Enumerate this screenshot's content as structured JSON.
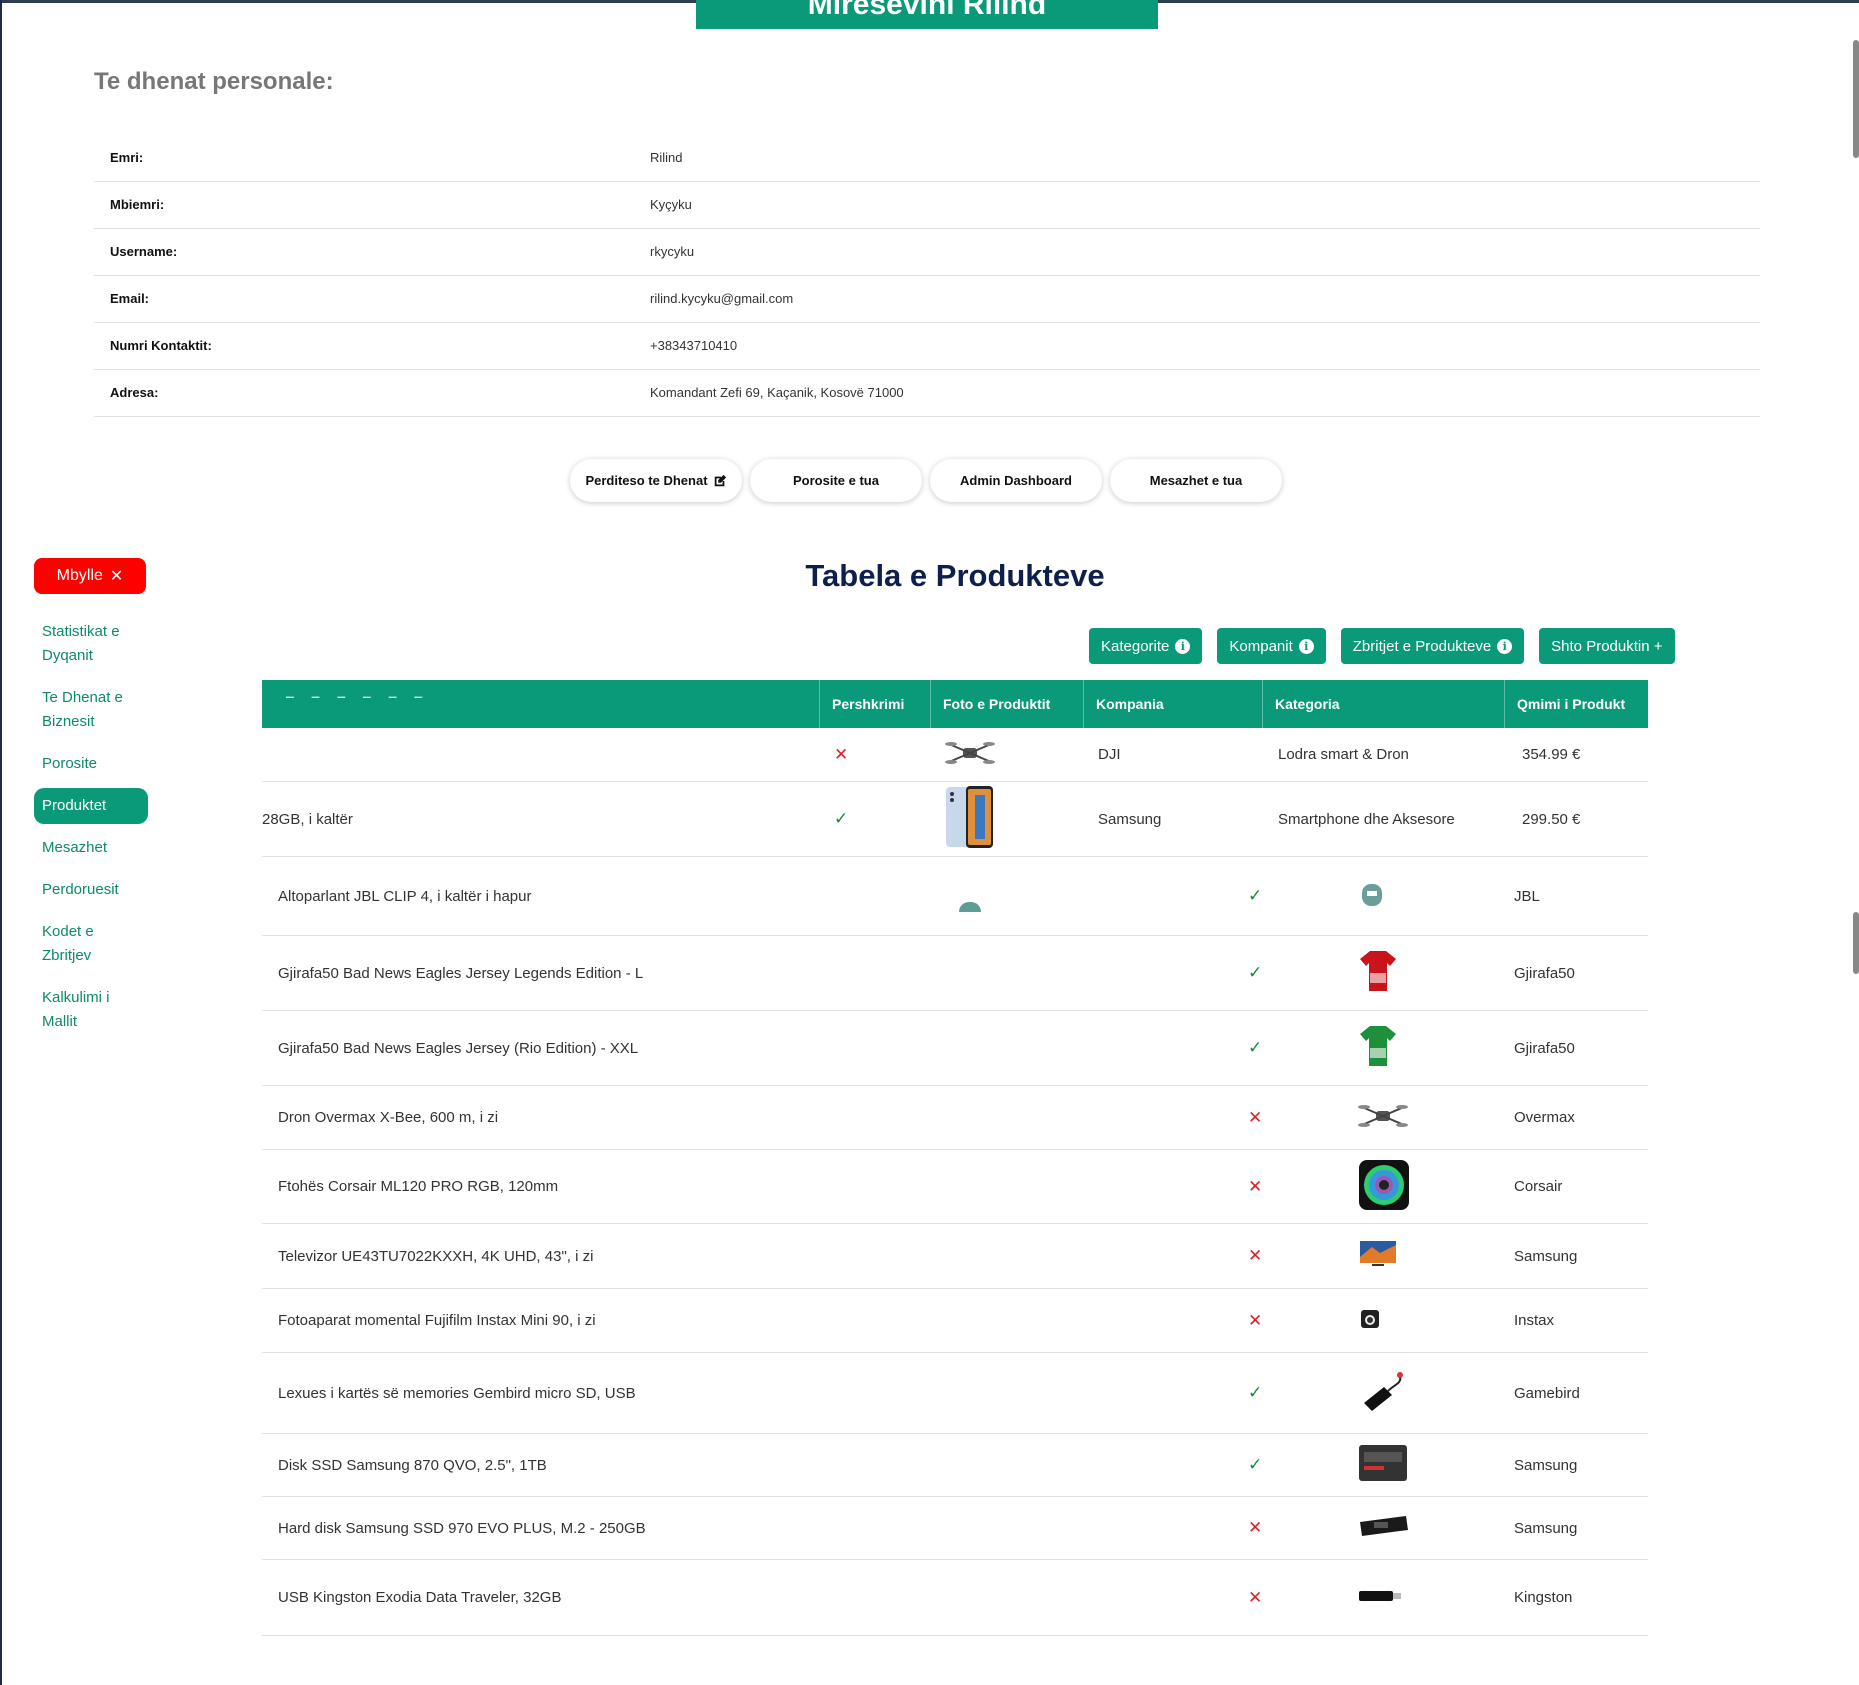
{
  "banner": {
    "title": "Mirësevini Rilind"
  },
  "profile": {
    "section_title": "Te dhenat personale:",
    "rows": [
      {
        "label": "Emri:",
        "value": "Rilind"
      },
      {
        "label": "Mbiemri:",
        "value": "Kyçyku"
      },
      {
        "label": "Username:",
        "value": "rkycyku"
      },
      {
        "label": "Email:",
        "value": "rilind.kycyku@gmail.com"
      },
      {
        "label": "Numri Kontaktit:",
        "value": "+38343710410"
      },
      {
        "label": "Adresa:",
        "value": "Komandant Zefi 69, Kaçanik, Kosovë 71000"
      }
    ]
  },
  "actions": {
    "update": "Perditeso te Dhenat",
    "orders": "Porosite e tua",
    "admin": "Admin Dashboard",
    "messages": "Mesazhet e tua"
  },
  "sidebar": {
    "close_label": "Mbylle",
    "items": [
      {
        "label": "Statistikat e Dyqanit",
        "active": false
      },
      {
        "label": "Te Dhenat e Biznesit",
        "active": false
      },
      {
        "label": "Porosite",
        "active": false
      },
      {
        "label": "Produktet",
        "active": true
      },
      {
        "label": "Mesazhet",
        "active": false
      },
      {
        "label": "Perdoruesit",
        "active": false
      },
      {
        "label": "Kodet e Zbritjev",
        "active": false
      },
      {
        "label": "Kalkulimi i Mallit",
        "active": false
      }
    ]
  },
  "products": {
    "title": "Tabela e Produkteve",
    "buttons": {
      "categories": "Kategorite",
      "companies": "Kompanit",
      "discounts": "Zbritjet e Produkteve",
      "add": "Shto Produktin +"
    },
    "headers": {
      "desc": "Pershkrimi",
      "photo": "Foto e Produktit",
      "company": "Kompania",
      "category": "Kategoria",
      "price": "Qmimi i Produkt"
    },
    "top_rows": [
      {
        "name": "",
        "desc_ok": false,
        "photo": "drone-photo",
        "company": "DJI",
        "category": "Lodra smart & Dron",
        "price": "354.99 €"
      },
      {
        "name": "28GB, i kaltër",
        "desc_ok": true,
        "photo": "phone-photo",
        "company": "Samsung",
        "category": "Smartphone dhe Aksesore",
        "price": "299.50 €"
      }
    ],
    "rows": [
      {
        "name": "Altoparlant JBL CLIP 4, i kaltër i hapur",
        "desc_ok": true,
        "photo": "speaker-photo",
        "company": "JBL"
      },
      {
        "name": "Gjirafa50 Bad News Eagles Jersey Legends Edition - L",
        "desc_ok": true,
        "photo": "red-jersey-photo",
        "company": "Gjirafa50"
      },
      {
        "name": "Gjirafa50 Bad News Eagles Jersey (Rio Edition) - XXL",
        "desc_ok": true,
        "photo": "green-jersey-photo",
        "company": "Gjirafa50"
      },
      {
        "name": "Dron Overmax X-Bee, 600 m, i zi",
        "desc_ok": false,
        "photo": "drone-photo",
        "company": "Overmax"
      },
      {
        "name": "Ftohës Corsair ML120 PRO RGB, 120mm",
        "desc_ok": false,
        "photo": "fan-photo",
        "company": "Corsair"
      },
      {
        "name": "Televizor UE43TU7022KXXH, 4K UHD, 43\", i zi",
        "desc_ok": false,
        "photo": "tv-photo",
        "company": "Samsung"
      },
      {
        "name": "Fotoaparat momental Fujifilm Instax Mini 90, i zi",
        "desc_ok": false,
        "photo": "camera-photo",
        "company": "Instax"
      },
      {
        "name": "Lexues i kartës së memories Gembird micro SD, USB",
        "desc_ok": true,
        "photo": "card-reader-photo",
        "company": "Gamebird"
      },
      {
        "name": "Disk SSD Samsung 870 QVO, 2.5\", 1TB",
        "desc_ok": true,
        "photo": "ssd-photo",
        "company": "Samsung"
      },
      {
        "name": "Hard disk Samsung SSD 970 EVO PLUS, M.2 - 250GB",
        "desc_ok": false,
        "photo": "m2-ssd-photo",
        "company": "Samsung"
      },
      {
        "name": "USB Kingston Exodia Data Traveler, 32GB",
        "desc_ok": false,
        "photo": "usb-photo",
        "company": "Kingston"
      }
    ]
  }
}
